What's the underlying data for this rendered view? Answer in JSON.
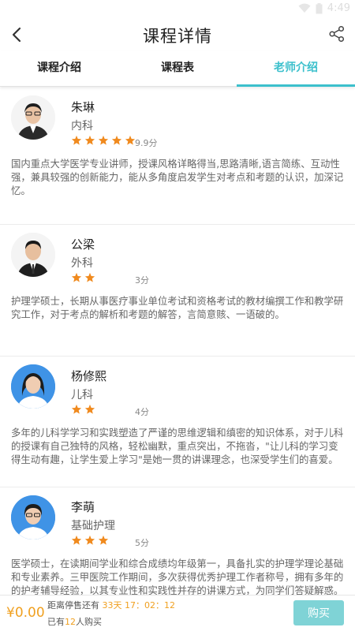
{
  "status_bar": {
    "time": "4:49"
  },
  "header": {
    "title": "课程详情",
    "back_icon": "back-arrow-icon",
    "share_icon": "share-icon"
  },
  "tabs": [
    {
      "label": "课程介绍",
      "active": false
    },
    {
      "label": "课程表",
      "active": false
    },
    {
      "label": "老师介绍",
      "active": true
    }
  ],
  "teachers": [
    {
      "name": "朱琳",
      "subject": "内科",
      "rating": 5,
      "score": "9.9分",
      "description": "国内重点大学医学专业讲师，授课风格详略得当,思路清晰,语言简练、互动性强，兼具较强的创新能力，能从多角度启发学生对考点和考题的认识，加深记忆。"
    },
    {
      "name": "公梁",
      "subject": "外科",
      "rating": 2,
      "score": "3分",
      "description": "护理学硕士，长期从事医疗事业单位考试和资格考试的教材编撰工作和教学研究工作，对于考点的解析和考题的解答，言简意赅、一语破的。"
    },
    {
      "name": "杨修熙",
      "subject": "儿科",
      "rating": 2,
      "score": "4分",
      "description": "多年的儿科学学习和实践塑造了严谨的思维逻辑和缜密的知识体系，对于儿科的授课有自己独特的风格，轻松幽默，重点突出，不拖沓，\"让儿科的学习变得生动有趣，让学生爱上学习\"是她一贯的讲课理念，也深受学生们的喜爱。"
    },
    {
      "name": "李萌",
      "subject": "基础护理",
      "rating": 3,
      "score": "5分",
      "description": "医学硕士，在读期间学业和综合成绩均年级第一，具备扎实的护理学理论基础和专业素养。三甲医院工作期间，多次获得优秀护理工作者称号，拥有多年的的护考辅导经验，以其专业性和实践性并存的讲课方式，为同学们答疑解惑。"
    }
  ],
  "bottom_bar": {
    "price": "¥0.00",
    "countdown_prefix": "距离停售还有",
    "countdown_value": "33天 17：02：12",
    "bought_prefix": "已有",
    "bought_count": "12",
    "bought_suffix": "人购买",
    "buy_label": "购买"
  },
  "colors": {
    "accent": "#3cc0cc",
    "star": "#f08a1e",
    "price": "#f0a020",
    "buy_button": "#7fd3d6"
  }
}
